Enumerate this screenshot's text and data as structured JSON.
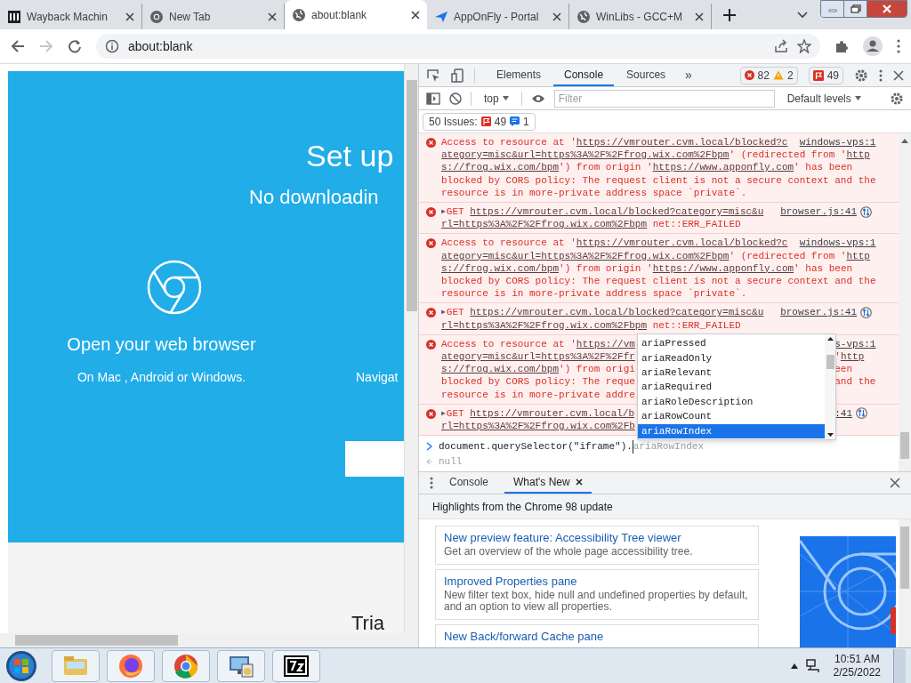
{
  "browser_tabs": [
    {
      "title": "Wayback Machin",
      "kind": "archive",
      "selected": false
    },
    {
      "title": "New Tab",
      "kind": "chrome",
      "selected": false
    },
    {
      "title": "about:blank",
      "kind": "globe",
      "selected": true
    },
    {
      "title": "AppOnFly - Portal",
      "kind": "plane",
      "selected": false
    },
    {
      "title": "WinLibs - GCC+M",
      "kind": "globe",
      "selected": false
    }
  ],
  "address_bar": {
    "url": "about:blank"
  },
  "page": {
    "heading": "Set up",
    "subheading": "No downloadin",
    "step_title": "Open your web browser",
    "step_text": "On Mac , Android or Windows.",
    "step2_text": "Navigat",
    "lower_heading": "Tria"
  },
  "devtools": {
    "tabs": [
      {
        "label": "Elements",
        "selected": false
      },
      {
        "label": "Console",
        "selected": true
      },
      {
        "label": "Sources",
        "selected": false
      }
    ],
    "more_tabs": "»",
    "counters": {
      "errors": "82",
      "warnings": "2",
      "issues": "49"
    },
    "context": "top",
    "filter_placeholder": "Filter",
    "levels": "Default levels",
    "issues_bar": {
      "label": "50 Issues:",
      "errors": "49",
      "info": "1"
    },
    "messages": [
      {
        "kind": "error",
        "occluded": false,
        "lines": [
          {
            "left": [
              {
                "t": "Access to resource at '"
              },
              {
                "t": "https://vmrouter.cvm.local/blocked?c",
                "link": true
              }
            ],
            "right": [
              {
                "t": "windows-vps:1",
                "link": true
              }
            ]
          },
          {
            "left": [
              {
                "t": "ategory=misc&url=https%3A%2F%2Ffrog.wix.com%2Fbpm",
                "link": true
              },
              {
                "t": "' (redirected from '"
              },
              {
                "t": "http",
                "link": true
              }
            ]
          },
          {
            "left": [
              {
                "t": "s://frog.wix.com/bpm",
                "link": true
              },
              {
                "t": "') from origin '"
              },
              {
                "t": "https://www.apponfly.com",
                "link": true
              },
              {
                "t": "' has been"
              }
            ]
          },
          {
            "left": [
              {
                "t": "blocked by CORS policy: The request client is not a secure context and the"
              }
            ]
          },
          {
            "left": [
              {
                "t": "resource is in more-private address space `private`."
              }
            ]
          }
        ]
      },
      {
        "kind": "network",
        "expander": "▶",
        "occluded": false,
        "lines": [
          {
            "left": [
              {
                "t": "GET "
              },
              {
                "t": "https://vmrouter.cvm.local/blocked?category=misc&u",
                "link": true
              }
            ],
            "right": [
              {
                "t": "browser.js:41",
                "link": true
              }
            ]
          },
          {
            "left": [
              {
                "t": "rl=https%3A%2F%2Ffrog.wix.com%2Fbpm",
                "link": true
              },
              {
                "t": " net::ERR_FAILED"
              }
            ]
          }
        ]
      },
      {
        "kind": "error",
        "occluded": false,
        "lines": [
          {
            "left": [
              {
                "t": "Access to resource at '"
              },
              {
                "t": "https://vmrouter.cvm.local/blocked?c",
                "link": true
              }
            ],
            "right": [
              {
                "t": "windows-vps:1",
                "link": true
              }
            ]
          },
          {
            "left": [
              {
                "t": "ategory=misc&url=https%3A%2F%2Ffrog.wix.com%2Fbpm",
                "link": true
              },
              {
                "t": "' (redirected from '"
              },
              {
                "t": "http",
                "link": true
              }
            ]
          },
          {
            "left": [
              {
                "t": "s://frog.wix.com/bpm",
                "link": true
              },
              {
                "t": "') from origin '"
              },
              {
                "t": "https://www.apponfly.com",
                "link": true
              },
              {
                "t": "' has been"
              }
            ]
          },
          {
            "left": [
              {
                "t": "blocked by CORS policy: The request client is not a secure context and the"
              }
            ]
          },
          {
            "left": [
              {
                "t": "resource is in more-private address space `private`."
              }
            ]
          }
        ]
      },
      {
        "kind": "network",
        "expander": "▶",
        "occluded": false,
        "lines": [
          {
            "left": [
              {
                "t": "GET "
              },
              {
                "t": "https://vmrouter.cvm.local/blocked?category=misc&u",
                "link": true
              }
            ],
            "right": [
              {
                "t": "browser.js:41",
                "link": true
              }
            ]
          },
          {
            "left": [
              {
                "t": "rl=https%3A%2F%2Ffrog.wix.com%2Fbpm",
                "link": true
              },
              {
                "t": " net::ERR_FAILED"
              }
            ]
          }
        ]
      },
      {
        "kind": "error",
        "occluded": true,
        "lines": [
          {
            "left": [
              {
                "t": "Access to resource at '"
              },
              {
                "t": "https://vm",
                "link": true
              }
            ],
            "right": [
              {
                "t": "s-vps:1",
                "link": true
              }
            ]
          },
          {
            "left": [
              {
                "t": "ategory=misc&url=https%3A%2F%2Ffr",
                "link": true
              }
            ],
            "right": [
              {
                "t": "'"
              },
              {
                "t": "http",
                "link": true
              }
            ]
          },
          {
            "left": [
              {
                "t": "s://frog.wix.com/bpm",
                "link": true
              },
              {
                "t": "') from origi"
              }
            ],
            "right": [
              {
                "t": "een"
              }
            ]
          },
          {
            "left": [
              {
                "t": "blocked by CORS policy: The reque"
              }
            ],
            "right": [
              {
                "t": "and the"
              }
            ]
          },
          {
            "left": [
              {
                "t": "resource is in more-private addre"
              }
            ]
          }
        ]
      },
      {
        "kind": "network",
        "expander": "▶",
        "occluded": true,
        "lines": [
          {
            "left": [
              {
                "t": "GET "
              },
              {
                "t": "https://vmrouter.cvm.local/b",
                "link": true
              }
            ],
            "right": [
              {
                "t": ":41",
                "link": true
              }
            ]
          },
          {
            "left": [
              {
                "t": "rl=https%3A%2F%2Ffrog.wix.com%2Fb",
                "link": true
              }
            ]
          }
        ]
      }
    ],
    "autocomplete": {
      "items": [
        {
          "label": "ariaPressed",
          "selected": false
        },
        {
          "label": "ariaReadOnly",
          "selected": false
        },
        {
          "label": "ariaRelevant",
          "selected": false
        },
        {
          "label": "ariaRequired",
          "selected": false
        },
        {
          "label": "ariaRoleDescription",
          "selected": false
        },
        {
          "label": "ariaRowCount",
          "selected": false
        },
        {
          "label": "ariaRowIndex",
          "selected": true
        }
      ]
    },
    "prompt": {
      "input": "document.querySelector(\"iframe\").",
      "suggestion": "ariaRowIndex"
    },
    "result": "null",
    "drawer": {
      "tabs": [
        {
          "label": "Console",
          "selected": false,
          "closable": false
        },
        {
          "label": "What's New",
          "selected": true,
          "closable": true
        }
      ],
      "header": "Highlights from the Chrome 98 update",
      "cards": [
        {
          "title": "New preview feature: Accessibility Tree viewer",
          "description": "Get an overview of the whole page accessibility tree."
        },
        {
          "title": "Improved Properties pane",
          "description": "New filter text box, hide null and undefined properties by default, and an option to view all properties."
        },
        {
          "title": "New Back/forward Cache pane"
        }
      ]
    }
  },
  "taskbar": {
    "apps": [
      {
        "kind": "folder"
      },
      {
        "kind": "firefox"
      },
      {
        "kind": "chrome"
      },
      {
        "kind": "remote"
      },
      {
        "kind": "archiver"
      }
    ],
    "time": "10:51 AM",
    "date": "2/25/2022"
  }
}
